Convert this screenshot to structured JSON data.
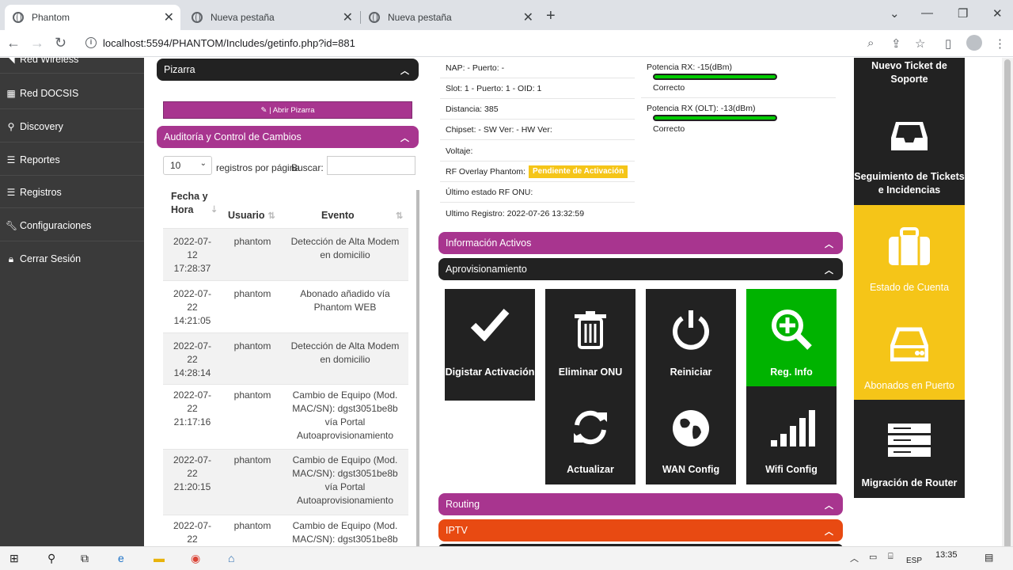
{
  "browser": {
    "tabs": [
      {
        "title": "Phantom",
        "active": true
      },
      {
        "title": "Nueva pestaña",
        "active": false
      },
      {
        "title": "Nueva pestaña",
        "active": false
      }
    ],
    "url": "localhost:5594/PHANTOM/Includes/getinfo.php?id=881"
  },
  "sidebar": {
    "items": [
      {
        "label": "Red Wireless",
        "icon": "wifi-icon"
      },
      {
        "label": "Red DOCSIS",
        "icon": "grid-icon"
      },
      {
        "label": "Discovery",
        "icon": "search-icon"
      },
      {
        "label": "Reportes",
        "icon": "list-icon"
      },
      {
        "label": "Registros",
        "icon": "list-icon"
      },
      {
        "label": "Configuraciones",
        "icon": "wrench-icon"
      },
      {
        "label": "Cerrar Sesión",
        "icon": "lock-icon"
      }
    ]
  },
  "left": {
    "pizarra": "Pizarra",
    "abrir_pizarra": "| Abrir Pizarra",
    "auditoria": "Auditoría y Control de Cambios",
    "per_page": "10",
    "per_page_label": "registros por página",
    "search_label": "Buscar:",
    "headers": {
      "fecha": "Fecha y Hora",
      "usuario": "Usuario",
      "evento": "Evento"
    },
    "rows": [
      {
        "fecha": "2022-07-12 17:28:37",
        "usuario": "phantom",
        "evento": "Detección de Alta Modem en domicilio"
      },
      {
        "fecha": "2022-07-22 14:21:05",
        "usuario": "phantom",
        "evento": "Abonado añadido vía Phantom WEB"
      },
      {
        "fecha": "2022-07-22 14:28:14",
        "usuario": "phantom",
        "evento": "Detección de Alta Modem en domicilio"
      },
      {
        "fecha": "2022-07-22 21:17:16",
        "usuario": "phantom",
        "evento": "Cambio de Equipo (Mod. MAC/SN): dgst3051be8b vía Portal Autoaprovisionamiento"
      },
      {
        "fecha": "2022-07-22 21:20:15",
        "usuario": "phantom",
        "evento": "Cambio de Equipo (Mod. MAC/SN): dgst3051be8b vía Portal Autoaprovisionamiento"
      },
      {
        "fecha": "2022-07-22",
        "usuario": "phantom",
        "evento": "Cambio de Equipo (Mod. MAC/SN): dgst3051be8b"
      }
    ]
  },
  "info": {
    "nap": "NAP: - Puerto: -",
    "slot": "Slot: 1 - Puerto: 1 - OID: 1",
    "distancia": "Distancia: 385",
    "chipset": "Chipset: - SW Ver: - HW Ver:",
    "voltaje": "Voltaje:",
    "rf_overlay": "RF Overlay Phantom:",
    "rf_status": "Pendiente de Activación",
    "ultimo_rf": "Último estado RF ONU:",
    "ultimo_registro": "Ultimo Registro: 2022-07-26 13:32:59",
    "potencia_rx": "Potencia RX: -15(dBm)",
    "potencia_rx_status": "Correcto",
    "potencia_olt": "Potencia RX (OLT): -13(dBm)",
    "potencia_olt_status": "Correcto"
  },
  "sections": {
    "activos": "Información Activos",
    "aprovisionamiento": "Aprovisionamiento",
    "routing": "Routing",
    "iptv": "IPTV"
  },
  "tiles": {
    "digistar": "Digistar Activación",
    "eliminar": "Eliminar ONU",
    "reiniciar": "Reiniciar",
    "reg_info": "Reg. Info",
    "actualizar": "Actualizar",
    "wan": "WAN Config",
    "wifi": "Wifi Config"
  },
  "right": {
    "nuevo_ticket": "Nuevo Ticket de Soporte",
    "seguimiento": "Seguimiento de Tickets e Incidencias",
    "estado_cuenta": "Estado de Cuenta",
    "abonados": "Abonados en Puerto",
    "migracion": "Migración de Router"
  },
  "taskbar": {
    "lang": "ESP",
    "time": "13:35"
  },
  "colors": {
    "purple": "#a8358f",
    "orange": "#e84a12",
    "yellow": "#f5c518",
    "green": "#00b300",
    "dark": "#222222"
  }
}
